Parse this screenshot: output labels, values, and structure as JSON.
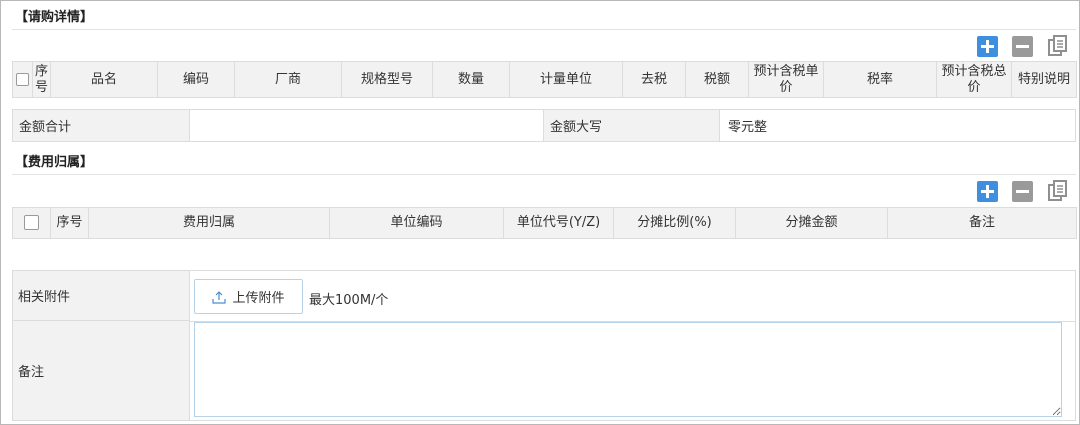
{
  "purchase": {
    "title": "【请购详情】",
    "columns": [
      "序号",
      "品名",
      "编码",
      "厂商",
      "规格型号",
      "数量",
      "计量单位",
      "去税",
      "税额",
      "预计含税单价",
      "税率",
      "预计含税总价",
      "特别说明"
    ]
  },
  "totals": {
    "amount_label": "金额合计",
    "amount_value": "",
    "uppercase_label": "金额大写",
    "uppercase_value": "零元整"
  },
  "expense": {
    "title": "【费用归属】",
    "columns": [
      "序号",
      "费用归属",
      "单位编码",
      "单位代号(Y/Z)",
      "分摊比例(%)",
      "分摊金额",
      "备注"
    ]
  },
  "attachments": {
    "label": "相关附件",
    "upload_label": "上传附件",
    "limit_text": "最大100M/个"
  },
  "remarks": {
    "label": "备注",
    "value": ""
  },
  "toolbar": {
    "add_icon": "plus-icon",
    "remove_icon": "minus-icon",
    "copy_icon": "copy-icon"
  },
  "colors": {
    "add": "#3f8fdf",
    "remove": "#9a9a9a",
    "header_bg": "#f2f2f2",
    "border": "#dcdcdc"
  }
}
